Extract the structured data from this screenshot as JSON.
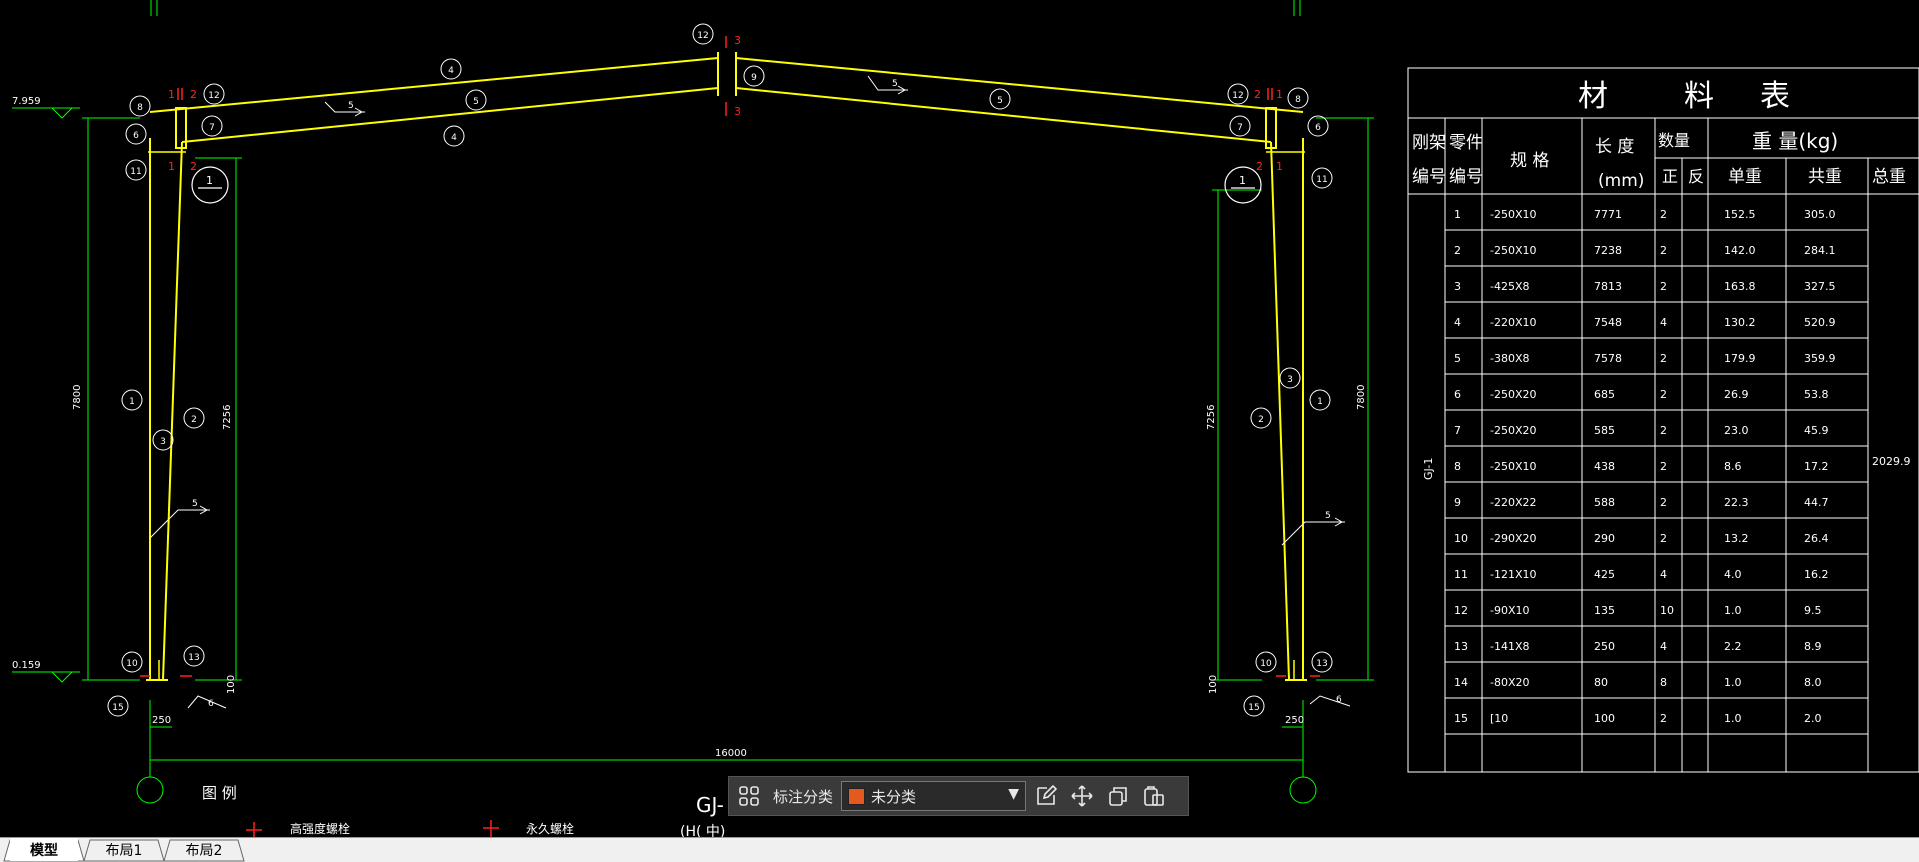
{
  "table": {
    "title_chars": [
      "材",
      "料",
      "表"
    ],
    "headers": {
      "gj_no": [
        "刚架",
        "编号"
      ],
      "part_no": [
        "零件",
        "编号"
      ],
      "spec": "规  格",
      "length": [
        "长  度",
        "(mm)"
      ],
      "qty": "数量",
      "qty_pos": "正",
      "qty_neg": "反",
      "weight": "重  量(kg)",
      "unit_w": "单重",
      "sum_w": "共重",
      "total": "总重"
    },
    "gj_label": "GJ-1",
    "total_value": "2029.9",
    "rows": [
      {
        "no": "1",
        "spec": "-250X10",
        "len": "7771",
        "qty": "2",
        "unit": "152.5",
        "sum": "305.0"
      },
      {
        "no": "2",
        "spec": "-250X10",
        "len": "7238",
        "qty": "2",
        "unit": "142.0",
        "sum": "284.1"
      },
      {
        "no": "3",
        "spec": "-425X8",
        "len": "7813",
        "qty": "2",
        "unit": "163.8",
        "sum": "327.5"
      },
      {
        "no": "4",
        "spec": "-220X10",
        "len": "7548",
        "qty": "4",
        "unit": "130.2",
        "sum": "520.9"
      },
      {
        "no": "5",
        "spec": "-380X8",
        "len": "7578",
        "qty": "2",
        "unit": "179.9",
        "sum": "359.9"
      },
      {
        "no": "6",
        "spec": "-250X20",
        "len": "685",
        "qty": "2",
        "unit": "26.9",
        "sum": "53.8"
      },
      {
        "no": "7",
        "spec": "-250X20",
        "len": "585",
        "qty": "2",
        "unit": "23.0",
        "sum": "45.9"
      },
      {
        "no": "8",
        "spec": "-250X10",
        "len": "438",
        "qty": "2",
        "unit": "8.6",
        "sum": "17.2"
      },
      {
        "no": "9",
        "spec": "-220X22",
        "len": "588",
        "qty": "2",
        "unit": "22.3",
        "sum": "44.7"
      },
      {
        "no": "10",
        "spec": "-290X20",
        "len": "290",
        "qty": "2",
        "unit": "13.2",
        "sum": "26.4"
      },
      {
        "no": "11",
        "spec": "-121X10",
        "len": "425",
        "qty": "4",
        "unit": "4.0",
        "sum": "16.2"
      },
      {
        "no": "12",
        "spec": "-90X10",
        "len": "135",
        "qty": "10",
        "unit": "1.0",
        "sum": "9.5"
      },
      {
        "no": "13",
        "spec": "-141X8",
        "len": "250",
        "qty": "4",
        "unit": "2.2",
        "sum": "8.9"
      },
      {
        "no": "14",
        "spec": "-80X20",
        "len": "80",
        "qty": "8",
        "unit": "1.0",
        "sum": "8.0"
      },
      {
        "no": "15",
        "spec": "[10",
        "len": "100",
        "qty": "2",
        "unit": "1.0",
        "sum": "2.0"
      }
    ]
  },
  "drawing": {
    "elev_top": "7.959",
    "elev_bottom": "0.159",
    "height_outer": "7800",
    "height_inner": "7256",
    "span": "16000",
    "base_width": "250",
    "base_small": "100",
    "legend_title": "图  例",
    "legend_hsbolt": "高强度螺栓",
    "legend_bolt": "永久螺栓",
    "gj_label_partial": "GJ-",
    "gj_sub_partial": "(H(  中)",
    "balloons_left": [
      "8",
      "12",
      "6",
      "7",
      "11",
      "1",
      "2",
      "3",
      "10",
      "13",
      "15",
      "4",
      "5"
    ],
    "balloons_right": [
      "8",
      "12",
      "6",
      "7",
      "11",
      "1",
      "2",
      "3",
      "10",
      "13",
      "15"
    ],
    "balloons_top": [
      "12",
      "9",
      "4",
      "5"
    ],
    "section_marks": [
      "1",
      "2",
      "3"
    ],
    "weld_symbol": "5",
    "weld_symbol_b": "6",
    "circle_label": "1"
  },
  "toolbar": {
    "annotate_label": "标注分类",
    "category_value": "未分类",
    "category_color": "#e5581e"
  },
  "tabs": [
    "模型",
    "布局1",
    "布局2"
  ],
  "colors": {
    "frame": "#ffff00",
    "dim": "#00ff00",
    "table_line": "#ffffff",
    "section": "#ff2020"
  }
}
